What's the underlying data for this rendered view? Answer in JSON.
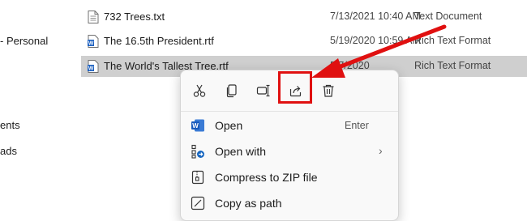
{
  "nav": {
    "items": [
      {
        "label": "- Personal"
      },
      {
        "label": "ents"
      },
      {
        "label": "ads"
      }
    ]
  },
  "files": [
    {
      "name": "732 Trees.txt",
      "date": "7/13/2021 10:40 AM",
      "type": "Text Document",
      "icon": "text-file-icon",
      "selected": false
    },
    {
      "name": "The 16.5th President.rtf",
      "date": "5/19/2020 10:59 AM",
      "type": "Rich Text Format",
      "icon": "word-file-icon",
      "selected": false
    },
    {
      "name": "The World's Tallest Tree.rtf",
      "date": "5/7/2020",
      "type": "Rich Text Format",
      "icon": "word-file-icon",
      "selected": true
    }
  ],
  "context_menu": {
    "toolbar": [
      {
        "name": "cut-icon"
      },
      {
        "name": "copy-icon"
      },
      {
        "name": "rename-icon"
      },
      {
        "name": "share-icon",
        "highlighted": true
      },
      {
        "name": "delete-icon"
      }
    ],
    "items": [
      {
        "label": "Open",
        "shortcut": "Enter",
        "icon": "word-icon"
      },
      {
        "label": "Open with",
        "submenu": true,
        "chevron": "›",
        "icon": "open-with-icon"
      },
      {
        "label": "Compress to ZIP file",
        "icon": "zip-icon"
      },
      {
        "label": "Copy as path",
        "icon": "copy-path-icon"
      }
    ]
  },
  "annotation": {
    "color": "#e01010"
  }
}
